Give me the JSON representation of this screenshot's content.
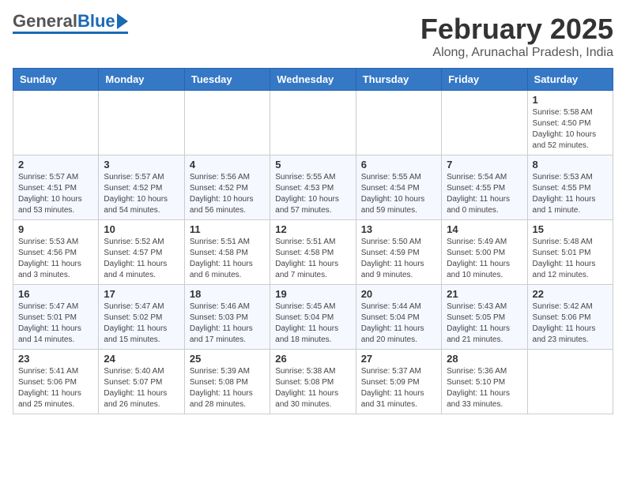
{
  "header": {
    "logo_general": "General",
    "logo_blue": "Blue",
    "month": "February 2025",
    "location": "Along, Arunachal Pradesh, India"
  },
  "weekdays": [
    "Sunday",
    "Monday",
    "Tuesday",
    "Wednesday",
    "Thursday",
    "Friday",
    "Saturday"
  ],
  "weeks": [
    [
      {
        "day": "",
        "info": ""
      },
      {
        "day": "",
        "info": ""
      },
      {
        "day": "",
        "info": ""
      },
      {
        "day": "",
        "info": ""
      },
      {
        "day": "",
        "info": ""
      },
      {
        "day": "",
        "info": ""
      },
      {
        "day": "1",
        "info": "Sunrise: 5:58 AM\nSunset: 4:50 PM\nDaylight: 10 hours\nand 52 minutes."
      }
    ],
    [
      {
        "day": "2",
        "info": "Sunrise: 5:57 AM\nSunset: 4:51 PM\nDaylight: 10 hours\nand 53 minutes."
      },
      {
        "day": "3",
        "info": "Sunrise: 5:57 AM\nSunset: 4:52 PM\nDaylight: 10 hours\nand 54 minutes."
      },
      {
        "day": "4",
        "info": "Sunrise: 5:56 AM\nSunset: 4:52 PM\nDaylight: 10 hours\nand 56 minutes."
      },
      {
        "day": "5",
        "info": "Sunrise: 5:55 AM\nSunset: 4:53 PM\nDaylight: 10 hours\nand 57 minutes."
      },
      {
        "day": "6",
        "info": "Sunrise: 5:55 AM\nSunset: 4:54 PM\nDaylight: 10 hours\nand 59 minutes."
      },
      {
        "day": "7",
        "info": "Sunrise: 5:54 AM\nSunset: 4:55 PM\nDaylight: 11 hours\nand 0 minutes."
      },
      {
        "day": "8",
        "info": "Sunrise: 5:53 AM\nSunset: 4:55 PM\nDaylight: 11 hours\nand 1 minute."
      }
    ],
    [
      {
        "day": "9",
        "info": "Sunrise: 5:53 AM\nSunset: 4:56 PM\nDaylight: 11 hours\nand 3 minutes."
      },
      {
        "day": "10",
        "info": "Sunrise: 5:52 AM\nSunset: 4:57 PM\nDaylight: 11 hours\nand 4 minutes."
      },
      {
        "day": "11",
        "info": "Sunrise: 5:51 AM\nSunset: 4:58 PM\nDaylight: 11 hours\nand 6 minutes."
      },
      {
        "day": "12",
        "info": "Sunrise: 5:51 AM\nSunset: 4:58 PM\nDaylight: 11 hours\nand 7 minutes."
      },
      {
        "day": "13",
        "info": "Sunrise: 5:50 AM\nSunset: 4:59 PM\nDaylight: 11 hours\nand 9 minutes."
      },
      {
        "day": "14",
        "info": "Sunrise: 5:49 AM\nSunset: 5:00 PM\nDaylight: 11 hours\nand 10 minutes."
      },
      {
        "day": "15",
        "info": "Sunrise: 5:48 AM\nSunset: 5:01 PM\nDaylight: 11 hours\nand 12 minutes."
      }
    ],
    [
      {
        "day": "16",
        "info": "Sunrise: 5:47 AM\nSunset: 5:01 PM\nDaylight: 11 hours\nand 14 minutes."
      },
      {
        "day": "17",
        "info": "Sunrise: 5:47 AM\nSunset: 5:02 PM\nDaylight: 11 hours\nand 15 minutes."
      },
      {
        "day": "18",
        "info": "Sunrise: 5:46 AM\nSunset: 5:03 PM\nDaylight: 11 hours\nand 17 minutes."
      },
      {
        "day": "19",
        "info": "Sunrise: 5:45 AM\nSunset: 5:04 PM\nDaylight: 11 hours\nand 18 minutes."
      },
      {
        "day": "20",
        "info": "Sunrise: 5:44 AM\nSunset: 5:04 PM\nDaylight: 11 hours\nand 20 minutes."
      },
      {
        "day": "21",
        "info": "Sunrise: 5:43 AM\nSunset: 5:05 PM\nDaylight: 11 hours\nand 21 minutes."
      },
      {
        "day": "22",
        "info": "Sunrise: 5:42 AM\nSunset: 5:06 PM\nDaylight: 11 hours\nand 23 minutes."
      }
    ],
    [
      {
        "day": "23",
        "info": "Sunrise: 5:41 AM\nSunset: 5:06 PM\nDaylight: 11 hours\nand 25 minutes."
      },
      {
        "day": "24",
        "info": "Sunrise: 5:40 AM\nSunset: 5:07 PM\nDaylight: 11 hours\nand 26 minutes."
      },
      {
        "day": "25",
        "info": "Sunrise: 5:39 AM\nSunset: 5:08 PM\nDaylight: 11 hours\nand 28 minutes."
      },
      {
        "day": "26",
        "info": "Sunrise: 5:38 AM\nSunset: 5:08 PM\nDaylight: 11 hours\nand 30 minutes."
      },
      {
        "day": "27",
        "info": "Sunrise: 5:37 AM\nSunset: 5:09 PM\nDaylight: 11 hours\nand 31 minutes."
      },
      {
        "day": "28",
        "info": "Sunrise: 5:36 AM\nSunset: 5:10 PM\nDaylight: 11 hours\nand 33 minutes."
      },
      {
        "day": "",
        "info": ""
      }
    ]
  ]
}
